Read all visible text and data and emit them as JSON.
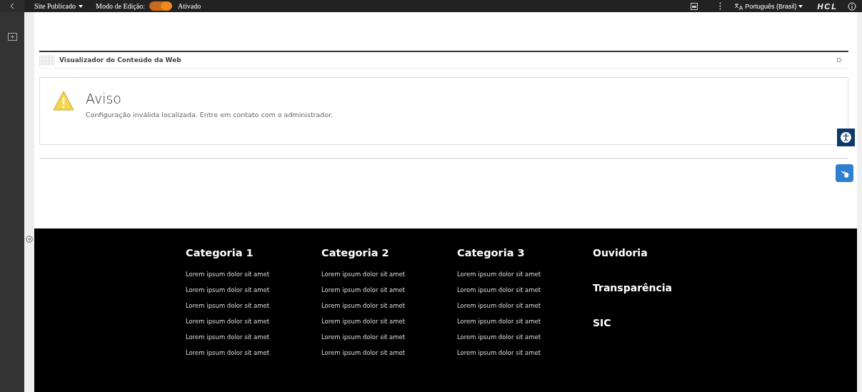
{
  "toolbar": {
    "site_menu": "Site Publicado",
    "edit_mode_label": "Modo de Edição:",
    "edit_mode_toggle": {
      "on": true
    },
    "edit_mode_state": "Ativado",
    "language": "Português (Brasil)",
    "logo": "HCL"
  },
  "portlet": {
    "title": "Visualizador do Conteúdo da Web",
    "alert": {
      "title": "Aviso",
      "message": "Configuração inválida localizada. Entre em contato com o administrador."
    }
  },
  "footer": {
    "categories": [
      {
        "title": "Categoria 1",
        "links": [
          "Lorem ipsum dolor sit amet",
          "Lorem ipsum dolor sit amet",
          "Lorem ipsum dolor sit amet",
          "Lorem ipsum dolor sit amet",
          "Lorem ipsum dolor sit amet",
          "Lorem ipsum dolor sit amet"
        ]
      },
      {
        "title": "Categoria 2",
        "links": [
          "Lorem ipsum dolor sit amet",
          "Lorem ipsum dolor sit amet",
          "Lorem ipsum dolor sit amet",
          "Lorem ipsum dolor sit amet",
          "Lorem ipsum dolor sit amet",
          "Lorem ipsum dolor sit amet"
        ]
      },
      {
        "title": "Categoria 3",
        "links": [
          "Lorem ipsum dolor sit amet",
          "Lorem ipsum dolor sit amet",
          "Lorem ipsum dolor sit amet",
          "Lorem ipsum dolor sit amet",
          "Lorem ipsum dolor sit amet",
          "Lorem ipsum dolor sit amet"
        ]
      }
    ],
    "links": [
      "Ouvidoria",
      "Transparência",
      "SIC"
    ]
  }
}
